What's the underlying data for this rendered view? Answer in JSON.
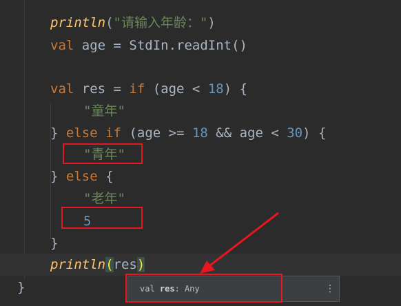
{
  "code": {
    "line1": {
      "fn": "println",
      "open": "(",
      "str": "\"请输入年龄：\"",
      "close": ")"
    },
    "line2": {
      "kw": "val",
      "rest": " age = StdIn.readInt()"
    },
    "line4": {
      "kw1": "val",
      "p1": " res = ",
      "kw2": "if",
      "p2": " (age < ",
      "num": "18",
      "p3": ") {"
    },
    "line5": {
      "str": "\"童年\""
    },
    "line6": {
      "p1": "} ",
      "kw1": "else",
      "p2": " ",
      "kw2": "if",
      "p3": " (age >= ",
      "num1": "18",
      "p4": " && age < ",
      "num2": "30",
      "p5": ") {"
    },
    "line7": {
      "str": "\"青年\""
    },
    "line8": {
      "p1": "} ",
      "kw": "else",
      "p2": " {"
    },
    "line9": {
      "str": "\"老年\""
    },
    "line10": {
      "num": "5"
    },
    "line11": {
      "text": "}"
    },
    "line12": {
      "fn": "println",
      "open": "(",
      "arg": "res",
      "close": ")"
    },
    "line13": {
      "text": "}"
    }
  },
  "popup": {
    "prefix": "val ",
    "name": "res",
    "suffix": ": Any",
    "more_icon": "more-vertical-icon"
  },
  "colors": {
    "background": "#2b2b2b",
    "keyword": "#cc7832",
    "function": "#ffc66d",
    "string": "#6a8759",
    "number": "#6897bb",
    "text": "#a9b7c6",
    "annotation_red": "#e8161e"
  }
}
